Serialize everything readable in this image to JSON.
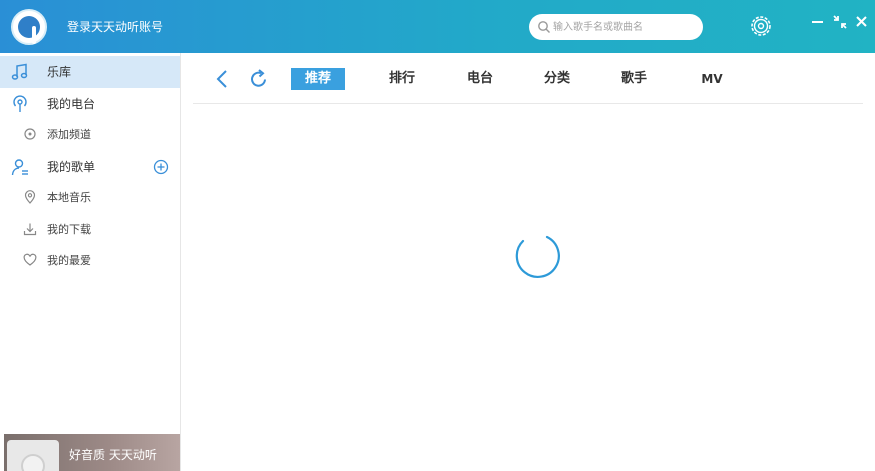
{
  "titlebar": {
    "login_text": "登录天天动听账号",
    "search_placeholder": "输入歌手名或歌曲名"
  },
  "sidebar": {
    "items": [
      {
        "label": "乐库",
        "icon": "music-note-icon"
      },
      {
        "label": "我的电台",
        "icon": "radio-icon"
      },
      {
        "label": "添加频道",
        "icon": "add-channel-icon"
      },
      {
        "label": "我的歌单",
        "icon": "user-playlist-icon"
      },
      {
        "label": "本地音乐",
        "icon": "location-icon"
      },
      {
        "label": "我的下载",
        "icon": "download-icon"
      },
      {
        "label": "我的最爱",
        "icon": "heart-icon"
      }
    ],
    "promo_text": "好音质 天天动听"
  },
  "main": {
    "tabs": [
      {
        "label": "推荐"
      },
      {
        "label": "排行"
      },
      {
        "label": "电台"
      },
      {
        "label": "分类"
      },
      {
        "label": "歌手"
      },
      {
        "label": "MV"
      }
    ]
  },
  "colors": {
    "titlebar_start": "#2a8fd6",
    "titlebar_end": "#21b3c4",
    "accent": "#3aa0df",
    "active_sidebar": "#d6e8f8"
  }
}
